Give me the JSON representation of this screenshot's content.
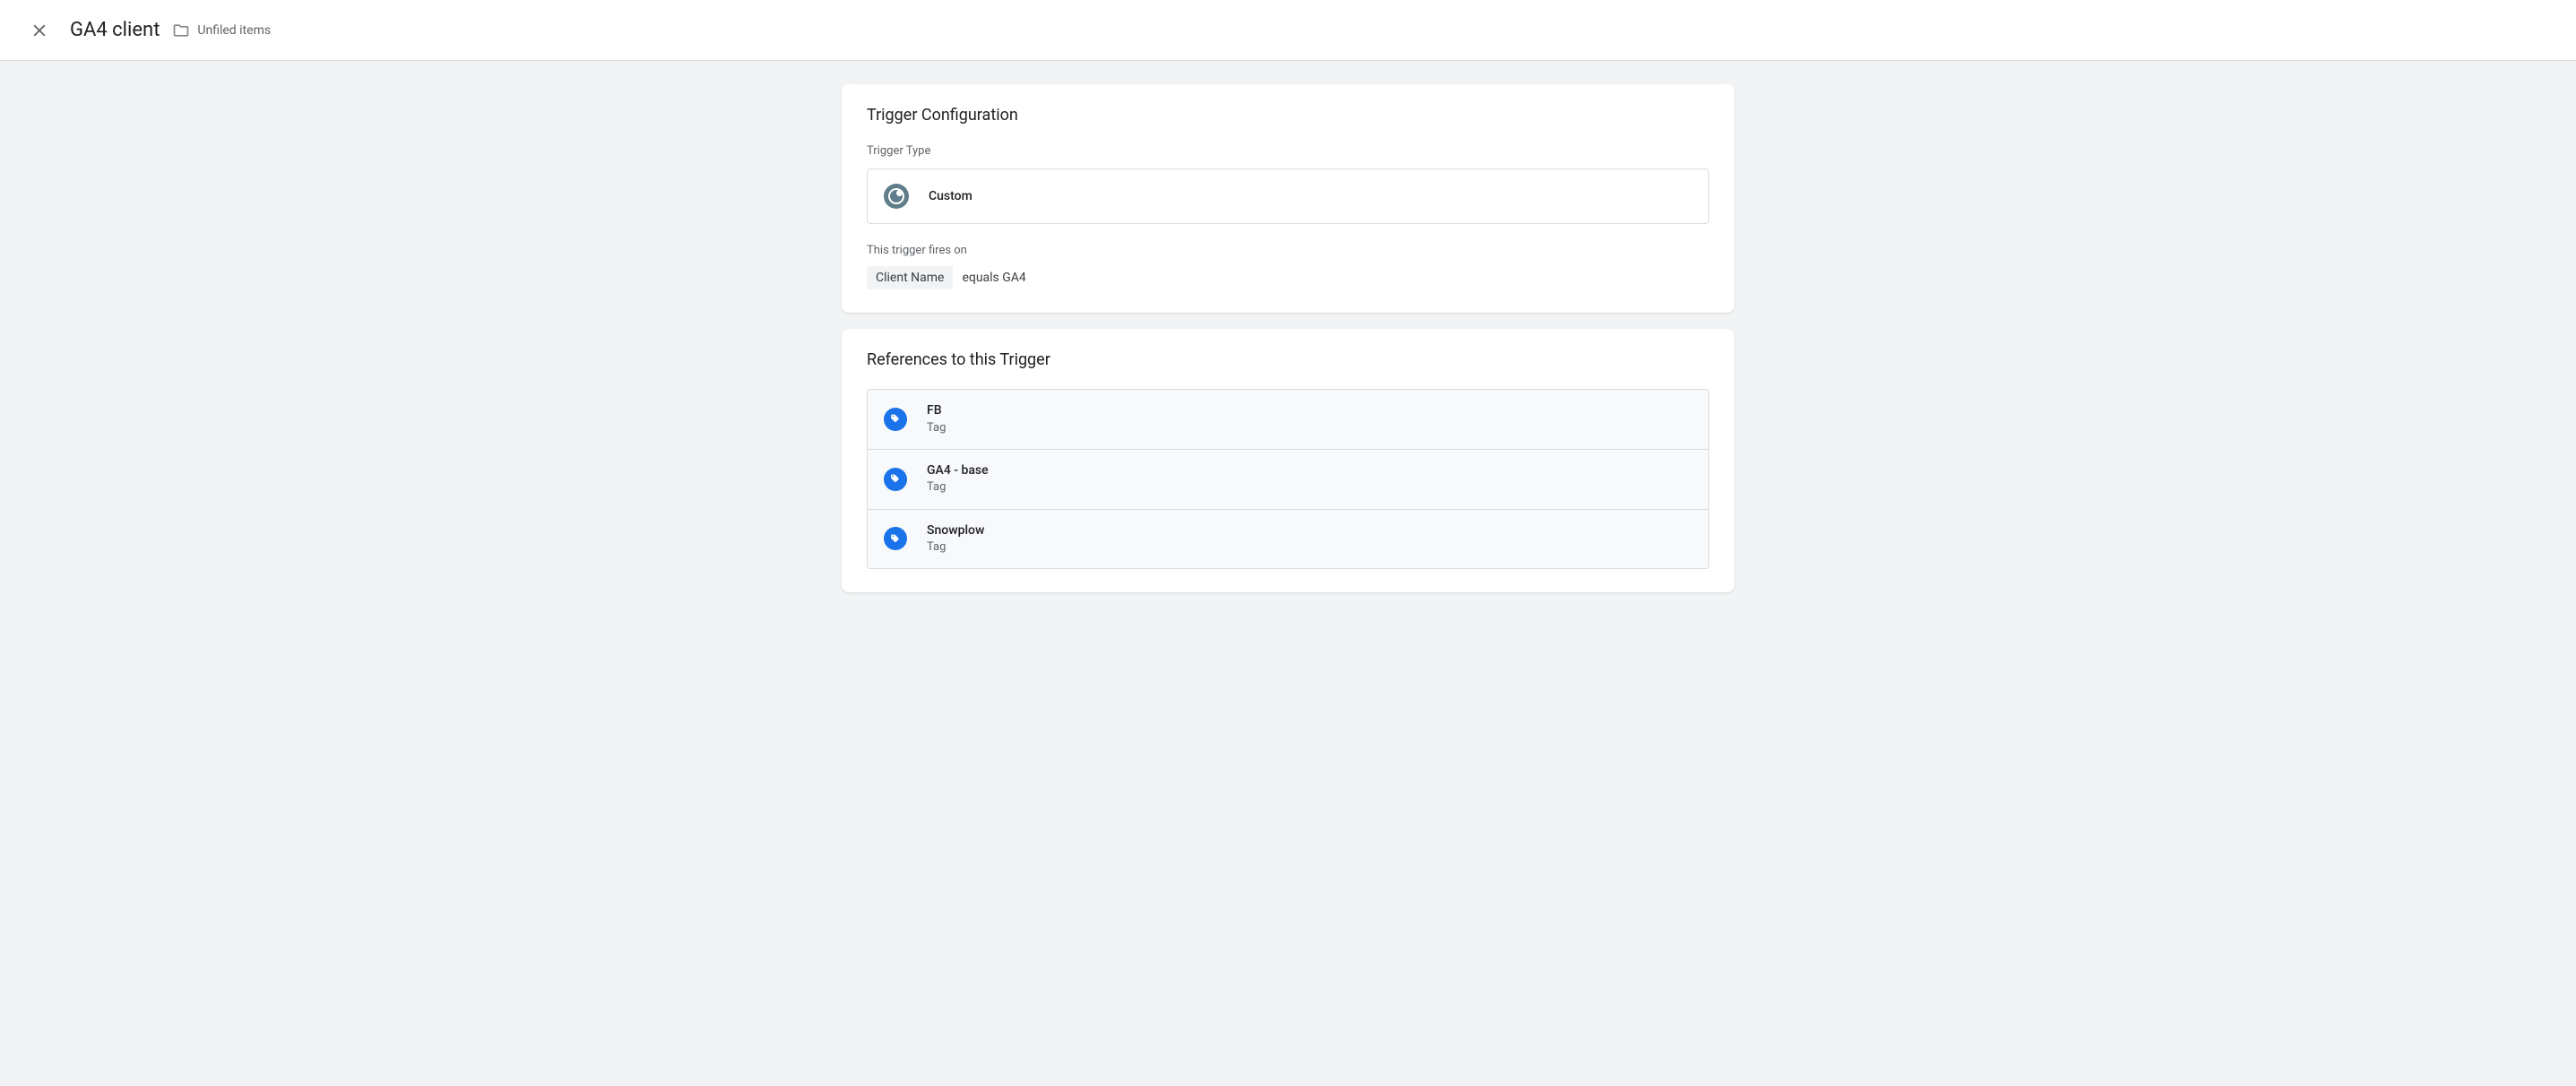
{
  "header": {
    "title": "GA4 client",
    "folder": "Unfiled items"
  },
  "trigger_config": {
    "title": "Trigger Configuration",
    "type_label": "Trigger Type",
    "type_name": "Custom",
    "fires_label": "This trigger fires on",
    "condition": {
      "variable": "Client Name",
      "operator_value": "equals GA4"
    }
  },
  "references": {
    "title": "References to this Trigger",
    "items": [
      {
        "name": "FB",
        "type": "Tag"
      },
      {
        "name": "GA4 - base",
        "type": "Tag"
      },
      {
        "name": "Snowplow",
        "type": "Tag"
      }
    ]
  }
}
